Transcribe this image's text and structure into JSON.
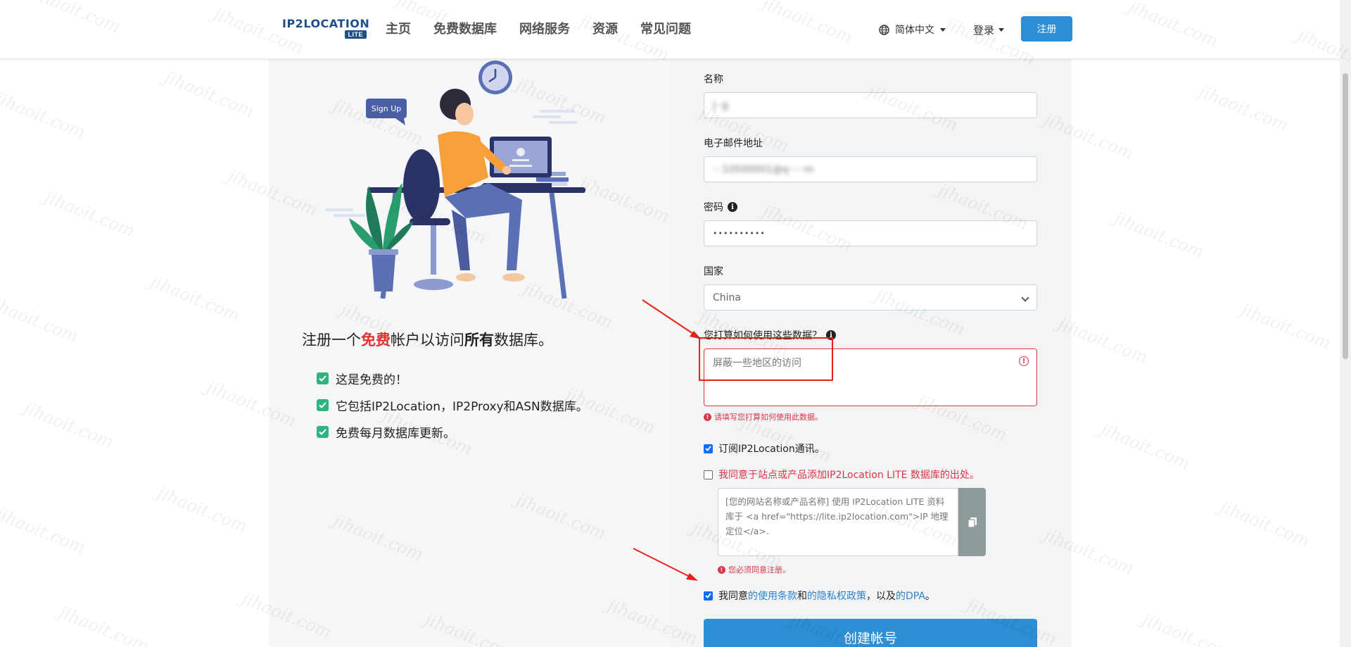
{
  "navbar": {
    "logo_text": "IP2LOCATION",
    "logo_badge": "LITE",
    "links": [
      "主页",
      "免费数据库",
      "网络服务",
      "资源",
      "常见问题"
    ],
    "language": "简体中文",
    "login": "登录",
    "signup": "注册"
  },
  "left": {
    "illustration_badge": "Sign Up",
    "headline_pre": "注册一个",
    "headline_free": "免费",
    "headline_mid": "帐户以访问",
    "headline_all": "所有",
    "headline_post": "数据库。",
    "features": [
      "这是免费的！",
      "它包括IP2Location，IP2Proxy和ASN数据库。",
      "免费每月数据库更新。"
    ]
  },
  "form": {
    "name_label": "名称",
    "name_value": "J··g",
    "email_label": "电子邮件地址",
    "email_value": "···10500001@q·····m",
    "password_label": "密码",
    "password_value": "••••••••••",
    "country_label": "国家",
    "country_value": "China",
    "usage_label": "您打算如何使用这些数据？",
    "usage_value": "屏蔽一些地区的访问",
    "usage_error": "请填写您打算如何使用此数据。",
    "newsletter_label": "订阅IP2Location通讯。",
    "attribution_label": "我同意于站点或产品添加IP2Location LITE 数据库的出处。",
    "attribution_code": "[您的网站名称或产品名称] 使用 IP2Location LITE 资料库于 <a href=\"https://lite.ip2location.com\">IP 地理定位</a>.",
    "attribution_error": "您必须同意注册。",
    "terms_pre": "我同意",
    "terms_link1": "的使用条款",
    "terms_and": "和",
    "terms_link2": "的隐私权政策",
    "terms_mid": "，以及",
    "terms_link3": "的DPA",
    "terms_end": "。",
    "create_button": "创建帐号"
  },
  "colors": {
    "primary": "#2d8ed4",
    "error": "#dc3545",
    "check_green": "#2fb380",
    "annotation_red": "#e8201c"
  },
  "watermark": "jihaoit.com"
}
